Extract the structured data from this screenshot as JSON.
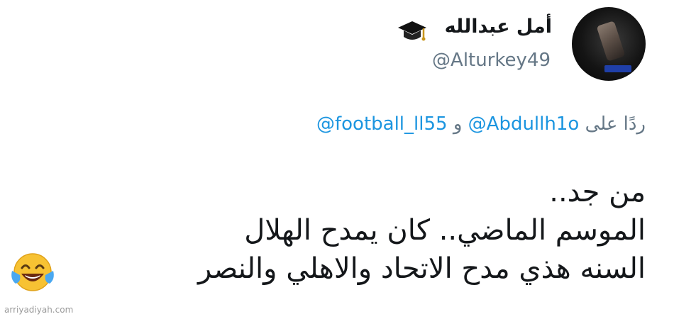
{
  "profile": {
    "display_name": "أمل عبدالله",
    "handle": "@Alturkey49",
    "badge_icon": "graduation-cap-icon"
  },
  "reply": {
    "prefix": "ردًا على",
    "mention_1": "@Abdullh1o",
    "joiner": "و",
    "mention_2": "@football_ll55"
  },
  "tweet": {
    "lines": [
      "من جد..",
      "الموسم الماضي.. كان يمدح الهلال",
      "السنه هذي مدح الاتحاد والاهلي والنصر"
    ],
    "emoji": "face-with-tears-of-joy-icon"
  },
  "watermark": "arriyadiyah.com",
  "colors": {
    "text": "#14171a",
    "secondary": "#657786",
    "link": "#1b95e0"
  }
}
